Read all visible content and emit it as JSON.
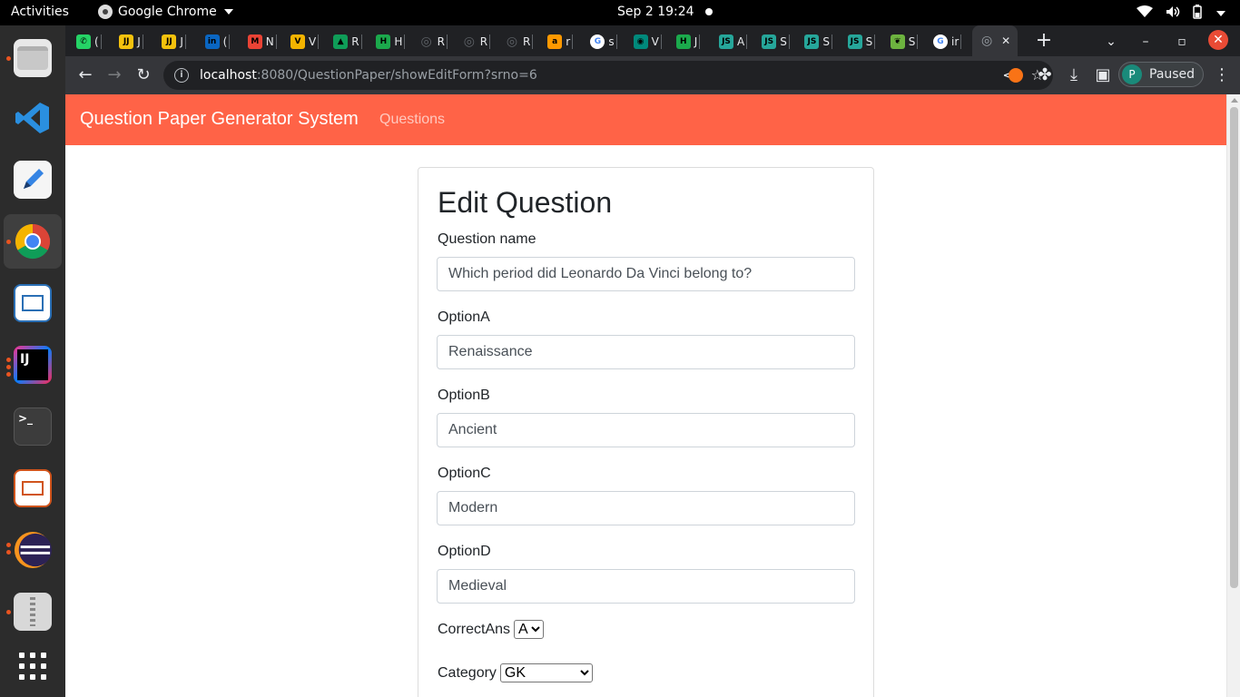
{
  "topbar": {
    "activities": "Activities",
    "app_name": "Google Chrome",
    "clock": "Sep 2  19:24"
  },
  "dock": {
    "items": [
      "files",
      "vscode",
      "text-editor",
      "chrome",
      "libreoffice-writer",
      "intellij",
      "terminal",
      "libreoffice-impress",
      "eclipse",
      "archive-manager",
      "app-grid"
    ]
  },
  "tabs": [
    {
      "icon": "whatsapp-icon",
      "label": "(",
      "color": "#25d366",
      "glyph": "✆"
    },
    {
      "icon": "jj-icon",
      "label": "J",
      "color": "#f4c20d",
      "glyph": "JJ"
    },
    {
      "icon": "jj-icon",
      "label": "J",
      "color": "#f4c20d",
      "glyph": "JJ"
    },
    {
      "icon": "linkedin-icon",
      "label": "(",
      "color": "#0a66c2",
      "glyph": "in"
    },
    {
      "icon": "gmail-icon",
      "label": "N",
      "color": "#ea4335",
      "glyph": "M"
    },
    {
      "icon": "v-icon",
      "label": "V",
      "color": "#f4b400",
      "glyph": "V"
    },
    {
      "icon": "drive-icon",
      "label": "R",
      "color": "#0f9d58",
      "glyph": "▲"
    },
    {
      "icon": "hackerrank-icon",
      "label": "H",
      "color": "#1ba94c",
      "glyph": "H"
    },
    {
      "icon": "globe-icon",
      "label": "R",
      "color": "#5f6368",
      "glyph": "◎"
    },
    {
      "icon": "globe-icon",
      "label": "R",
      "color": "#5f6368",
      "glyph": "◎"
    },
    {
      "icon": "globe-icon",
      "label": "R",
      "color": "#5f6368",
      "glyph": "◎"
    },
    {
      "icon": "amazon-icon",
      "label": "r",
      "color": "#ff9900",
      "glyph": "a"
    },
    {
      "icon": "google-icon",
      "label": "s",
      "color": "#ffffff",
      "glyph": "G"
    },
    {
      "icon": "eye-icon",
      "label": "V",
      "color": "#00897b",
      "glyph": "◉"
    },
    {
      "icon": "hackerrank-icon",
      "label": "J",
      "color": "#1ba94c",
      "glyph": "H"
    },
    {
      "icon": "jsp-icon",
      "label": "A",
      "color": "#26a69a",
      "glyph": "JS"
    },
    {
      "icon": "jsp-icon",
      "label": "S",
      "color": "#26a69a",
      "glyph": "JS"
    },
    {
      "icon": "jsp-icon",
      "label": "S",
      "color": "#26a69a",
      "glyph": "JS"
    },
    {
      "icon": "jsp-icon",
      "label": "S",
      "color": "#26a69a",
      "glyph": "JS"
    },
    {
      "icon": "spring-icon",
      "label": "S",
      "color": "#6db33f",
      "glyph": "❦"
    },
    {
      "icon": "google-icon",
      "label": "ir",
      "color": "#ffffff",
      "glyph": "G"
    },
    {
      "icon": "globe-icon",
      "label": "",
      "color": "#9aa0a6",
      "glyph": "◎",
      "active": true
    }
  ],
  "address": {
    "host": "localhost",
    "path": ":8080/QuestionPaper/showEditForm?srno=6"
  },
  "profile": {
    "initial": "P",
    "status": "Paused"
  },
  "page": {
    "brand": "Question Paper Generator System",
    "nav_link": "Questions",
    "form_title": "Edit Question",
    "fields": {
      "question_label": "Question name",
      "question_value": "Which period did Leonardo Da Vinci belong to?",
      "optionA_label": "OptionA",
      "optionA_value": "Renaissance",
      "optionB_label": "OptionB",
      "optionB_value": "Ancient",
      "optionC_label": "OptionC",
      "optionC_value": "Modern",
      "optionD_label": "OptionD",
      "optionD_value": "Medieval",
      "correct_label": "CorrectAns",
      "correct_value": "A",
      "category_label": "Category",
      "category_value": "GK"
    }
  },
  "colors": {
    "navbar": "#ff6347",
    "ubuntu_accent": "#e95420"
  }
}
